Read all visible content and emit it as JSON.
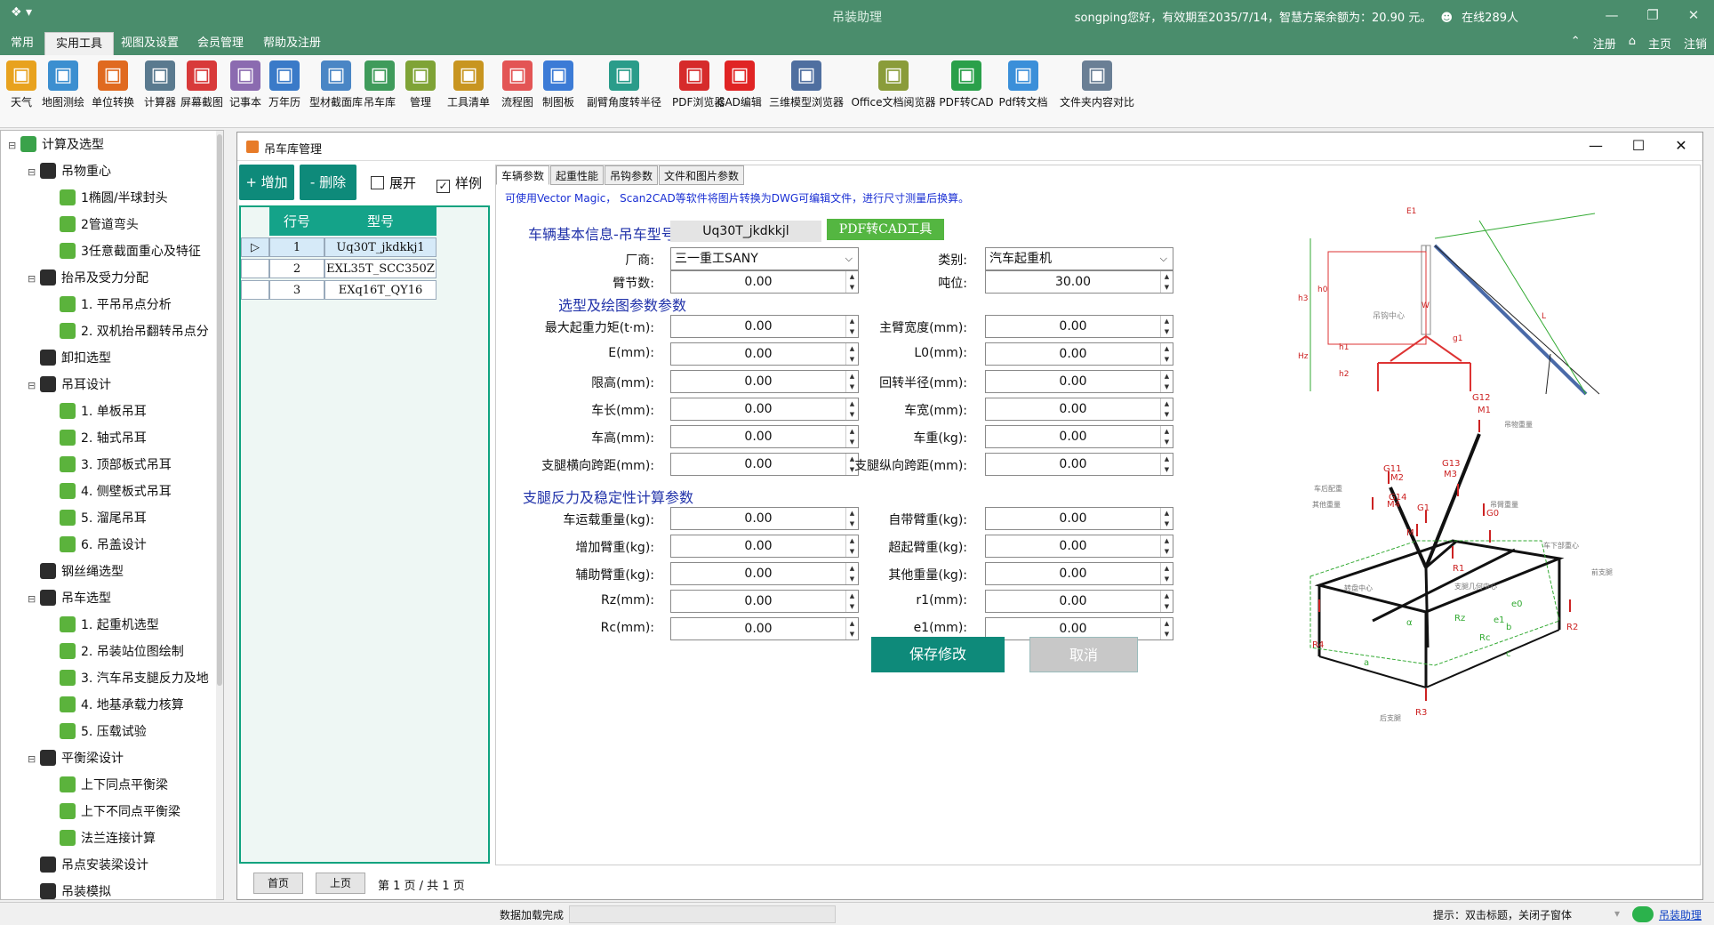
{
  "app": {
    "title": "吊装助理",
    "user_info": "songping您好，有效期至2035/7/14，智慧方案余额为：20.90 元。",
    "online": "在线289人"
  },
  "menu": {
    "items": [
      "常用",
      "实用工具",
      "视图及设置",
      "会员管理",
      "帮助及注册"
    ],
    "active": "实用工具",
    "right": [
      "注册",
      "主页",
      "注销"
    ]
  },
  "toolbar": {
    "items": [
      {
        "label": "天气",
        "icon": "weather-icon",
        "color": "#e8a21e"
      },
      {
        "label": "地图测绘",
        "icon": "map-icon",
        "color": "#3c8fd0"
      },
      {
        "label": "单位转换",
        "icon": "unit-convert-icon",
        "color": "#e06a20"
      },
      {
        "label": "计算器",
        "icon": "calculator-icon",
        "color": "#5a7a8f"
      },
      {
        "label": "屏幕截图",
        "icon": "screenshot-icon",
        "color": "#d83a3a"
      },
      {
        "label": "记事本",
        "icon": "notepad-icon",
        "color": "#8b6bb0"
      },
      {
        "label": "万年历",
        "icon": "calendar-icon",
        "color": "#3a7ac8"
      },
      {
        "label": "型材截面库",
        "icon": "profile-icon",
        "color": "#4a86c5"
      },
      {
        "label": "吊车库",
        "icon": "crane-lib-icon",
        "color": "#3f9b5b"
      },
      {
        "label": "管理",
        "icon": "manage-icon",
        "color": "#7fa336"
      },
      {
        "label": "工具清单",
        "icon": "checklist-icon",
        "color": "#c89520"
      },
      {
        "label": "流程图",
        "icon": "flowchart-icon",
        "color": "#e35555"
      },
      {
        "label": "制图板",
        "icon": "drawing-board-icon",
        "color": "#3c7bd6"
      },
      {
        "label": "副臂角度转半径",
        "icon": "angle-radius-icon",
        "color": "#2a9c8a"
      },
      {
        "label": "PDF浏览器",
        "icon": "pdf-icon",
        "color": "#d62b2b"
      },
      {
        "label": "CAD编辑",
        "icon": "cad-icon",
        "color": "#e02424"
      },
      {
        "label": "三维模型浏览器",
        "icon": "model3d-icon",
        "color": "#4f6fa0"
      },
      {
        "label": "Office文档阅览器",
        "icon": "office-icon",
        "color": "#8a9c3a"
      },
      {
        "label": "PDF转CAD",
        "icon": "pdf-to-cad-icon",
        "color": "#2aa04a"
      },
      {
        "label": "Pdf转文档",
        "icon": "pdf-to-doc-icon",
        "color": "#3b8fd9"
      },
      {
        "label": "文件夹内容对比",
        "icon": "folder-compare-icon",
        "color": "#6a7f95"
      }
    ]
  },
  "tree": {
    "nodes": [
      {
        "label": "计算及选型",
        "level": 0,
        "toggle": "⊟"
      },
      {
        "label": "吊物重心",
        "level": 1,
        "toggle": "⊟"
      },
      {
        "label": "1椭圆/半球封头",
        "level": 2,
        "toggle": ""
      },
      {
        "label": "2管道弯头",
        "level": 2,
        "toggle": ""
      },
      {
        "label": "3任意截面重心及特征",
        "level": 2,
        "toggle": ""
      },
      {
        "label": "抬吊及受力分配",
        "level": 1,
        "toggle": "⊟"
      },
      {
        "label": "1. 平吊吊点分析",
        "level": 2,
        "toggle": ""
      },
      {
        "label": "2. 双机抬吊翻转吊点分",
        "level": 2,
        "toggle": ""
      },
      {
        "label": "卸扣选型",
        "level": 1,
        "toggle": ""
      },
      {
        "label": "吊耳设计",
        "level": 1,
        "toggle": "⊟"
      },
      {
        "label": "1. 单板吊耳",
        "level": 2,
        "toggle": ""
      },
      {
        "label": "2. 轴式吊耳",
        "level": 2,
        "toggle": ""
      },
      {
        "label": "3. 顶部板式吊耳",
        "level": 2,
        "toggle": ""
      },
      {
        "label": "4. 侧壁板式吊耳",
        "level": 2,
        "toggle": ""
      },
      {
        "label": "5. 溜尾吊耳",
        "level": 2,
        "toggle": ""
      },
      {
        "label": "6. 吊盖设计",
        "level": 2,
        "toggle": ""
      },
      {
        "label": "钢丝绳选型",
        "level": 1,
        "toggle": ""
      },
      {
        "label": "吊车选型",
        "level": 1,
        "toggle": "⊟"
      },
      {
        "label": "1. 起重机选型",
        "level": 2,
        "toggle": ""
      },
      {
        "label": "2. 吊装站位图绘制",
        "level": 2,
        "toggle": ""
      },
      {
        "label": "3. 汽车吊支腿反力及地",
        "level": 2,
        "toggle": ""
      },
      {
        "label": "4. 地基承载力核算",
        "level": 2,
        "toggle": ""
      },
      {
        "label": "5. 压载试验",
        "level": 2,
        "toggle": ""
      },
      {
        "label": "平衡梁设计",
        "level": 1,
        "toggle": "⊟"
      },
      {
        "label": "上下同点平衡梁",
        "level": 2,
        "toggle": ""
      },
      {
        "label": "上下不同点平衡梁",
        "level": 2,
        "toggle": ""
      },
      {
        "label": "法兰连接计算",
        "level": 2,
        "toggle": ""
      },
      {
        "label": "吊点安装梁设计",
        "level": 1,
        "toggle": ""
      },
      {
        "label": "吊装模拟",
        "level": 1,
        "toggle": ""
      }
    ]
  },
  "window": {
    "title": "吊车库管理",
    "left": {
      "add": "+ 增加",
      "delete": "- 删除",
      "expand": "展开",
      "sample": "样例",
      "expand_checked": false,
      "sample_checked": true,
      "columns": [
        "行号",
        "型号"
      ],
      "rows": [
        [
          "1",
          "Uq30T_jkdkkj1"
        ],
        [
          "2",
          "EXL35T_SCC350Z"
        ],
        [
          "3",
          "EXq16T_QY16"
        ]
      ],
      "pager": {
        "first": "首页",
        "prev": "上页",
        "info": "第 1 页 / 共 1 页"
      }
    },
    "tabs": [
      "车辆参数",
      "起重性能",
      "吊钩参数",
      "文件和图片参数"
    ],
    "notice": "可使用Vector Magic， Scan2CAD等软件将图片转换为DWG可编辑文件，进行尺寸测量后换算。",
    "form": {
      "sec_basic": "车辆基本信息-吊车型号:",
      "model": "Uq30T_jkdkkjl",
      "pdf_btn": "PDF转CAD工具",
      "maker_label": "厂商:",
      "maker": "三一重工SANY",
      "type_label": "类别:",
      "type": "汽车起重机",
      "sections_label": "臂节数:",
      "sections": "0.00",
      "tonnage_label": "吨位:",
      "tonnage": "30.00",
      "sec_select": "选型及绘图参数参数",
      "fields_left": [
        {
          "label": "最大起重力矩(t·m):",
          "value": "0.00"
        },
        {
          "label": "E(mm):",
          "value": "0.00"
        },
        {
          "label": "限高(mm):",
          "value": "0.00"
        },
        {
          "label": "车长(mm):",
          "value": "0.00"
        },
        {
          "label": "车高(mm):",
          "value": "0.00"
        },
        {
          "label": "支腿横向跨距(mm):",
          "value": "0.00"
        }
      ],
      "fields_right": [
        {
          "label": "主臂宽度(mm):",
          "value": "0.00"
        },
        {
          "label": "L0(mm):",
          "value": "0.00"
        },
        {
          "label": "回转半径(mm):",
          "value": "0.00"
        },
        {
          "label": "车宽(mm):",
          "value": "0.00"
        },
        {
          "label": "车重(kg):",
          "value": "0.00"
        },
        {
          "label": "支腿纵向跨距(mm):",
          "value": "0.00"
        }
      ],
      "sec_leg": "支腿反力及稳定性计算参数",
      "fields_left2": [
        {
          "label": "车运载重量(kg):",
          "value": "0.00"
        },
        {
          "label": "增加臂重(kg):",
          "value": "0.00"
        },
        {
          "label": "辅助臂重(kg):",
          "value": "0.00"
        },
        {
          "label": "Rz(mm):",
          "value": "0.00"
        },
        {
          "label": "Rc(mm):",
          "value": "0.00"
        }
      ],
      "fields_right2": [
        {
          "label": "自带臂重(kg):",
          "value": "0.00"
        },
        {
          "label": "超起臂重(kg):",
          "value": "0.00"
        },
        {
          "label": "其他重量(kg):",
          "value": "0.00"
        },
        {
          "label": "r1(mm):",
          "value": "0.00"
        },
        {
          "label": "e1(mm):",
          "value": "0.00"
        }
      ],
      "save": "保存修改",
      "cancel": "取消"
    },
    "diagram_labels": {
      "top": [
        "E1",
        "h0",
        "h1",
        "h2",
        "h3",
        "W",
        "g1",
        "L",
        "吊钩中心",
        "Hz"
      ],
      "bottom": [
        "G12",
        "M1",
        "G11",
        "M2",
        "G13",
        "M3",
        "G14",
        "M4",
        "G1",
        "M",
        "G0",
        "R1",
        "R2",
        "R3",
        "R4",
        "α",
        "a",
        "b",
        "c",
        "Rc",
        "Rz",
        "e1",
        "e0",
        "吊物重量",
        "车后配重",
        "其他重量",
        "吊臂重量",
        "车下部重心",
        "前支腿",
        "后支腿",
        "转盘中心",
        "支腿几何中心"
      ]
    }
  },
  "bottom_status": "数据加载完成",
  "status": {
    "hint": "提示：双击标题，关闭子窗体",
    "link": "吊装助理"
  }
}
